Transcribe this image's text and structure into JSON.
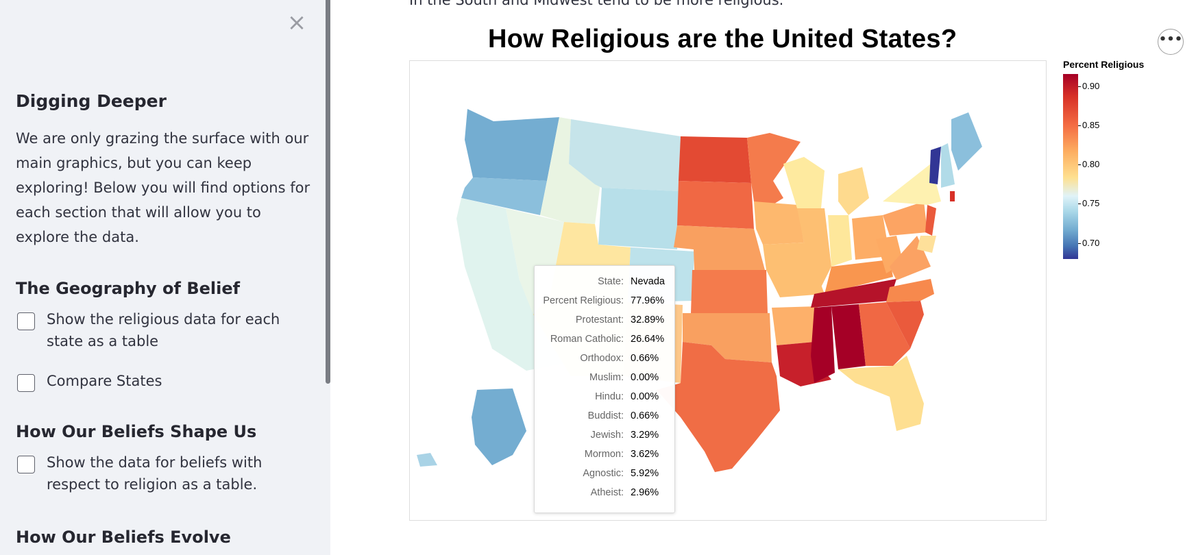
{
  "sidebar": {
    "close_label": "×",
    "heading": "Digging Deeper",
    "intro": "We are only grazing the surface with our main graphics, but you can keep exploring! Below you will find options for each section that will allow you to explore the data.",
    "sections": [
      {
        "title": "The Geography of Belief",
        "checkboxes": [
          {
            "label": "Show the religious data for each state as a table",
            "checked": false
          },
          {
            "label": "Compare States",
            "checked": false
          }
        ]
      },
      {
        "title": "How Our Beliefs Shape Us",
        "checkboxes": [
          {
            "label": "Show the data for beliefs with respect to religion as a table.",
            "checked": false
          }
        ]
      },
      {
        "title": "How Our Beliefs Evolve",
        "checkboxes": []
      }
    ]
  },
  "main": {
    "intro_fragment": "In the South and Midwest tend to be more religious.",
    "chart_title": "How Religious are the United States?",
    "menu_label": "•••"
  },
  "legend": {
    "title": "Percent Religious",
    "ticks": [
      "0.90",
      "0.85",
      "0.80",
      "0.75",
      "0.70"
    ]
  },
  "tooltip": {
    "rows": [
      {
        "key": "State:",
        "value": "Nevada"
      },
      {
        "key": "Percent Religious:",
        "value": "77.96%"
      },
      {
        "key": "Protestant:",
        "value": "32.89%"
      },
      {
        "key": "Roman Catholic:",
        "value": "26.64%"
      },
      {
        "key": "Orthodox:",
        "value": "0.66%"
      },
      {
        "key": "Muslim:",
        "value": "0.00%"
      },
      {
        "key": "Hindu:",
        "value": "0.00%"
      },
      {
        "key": "Buddist:",
        "value": "0.66%"
      },
      {
        "key": "Jewish:",
        "value": "3.29%"
      },
      {
        "key": "Mormon:",
        "value": "3.62%"
      },
      {
        "key": "Agnostic:",
        "value": "5.92%"
      },
      {
        "key": "Atheist:",
        "value": "2.96%"
      }
    ]
  },
  "colors": {
    "sidebar_bg": "#f0f2f6",
    "scale_high": "#a50026",
    "scale_mid": "#fee090",
    "scale_low": "#313695"
  }
}
